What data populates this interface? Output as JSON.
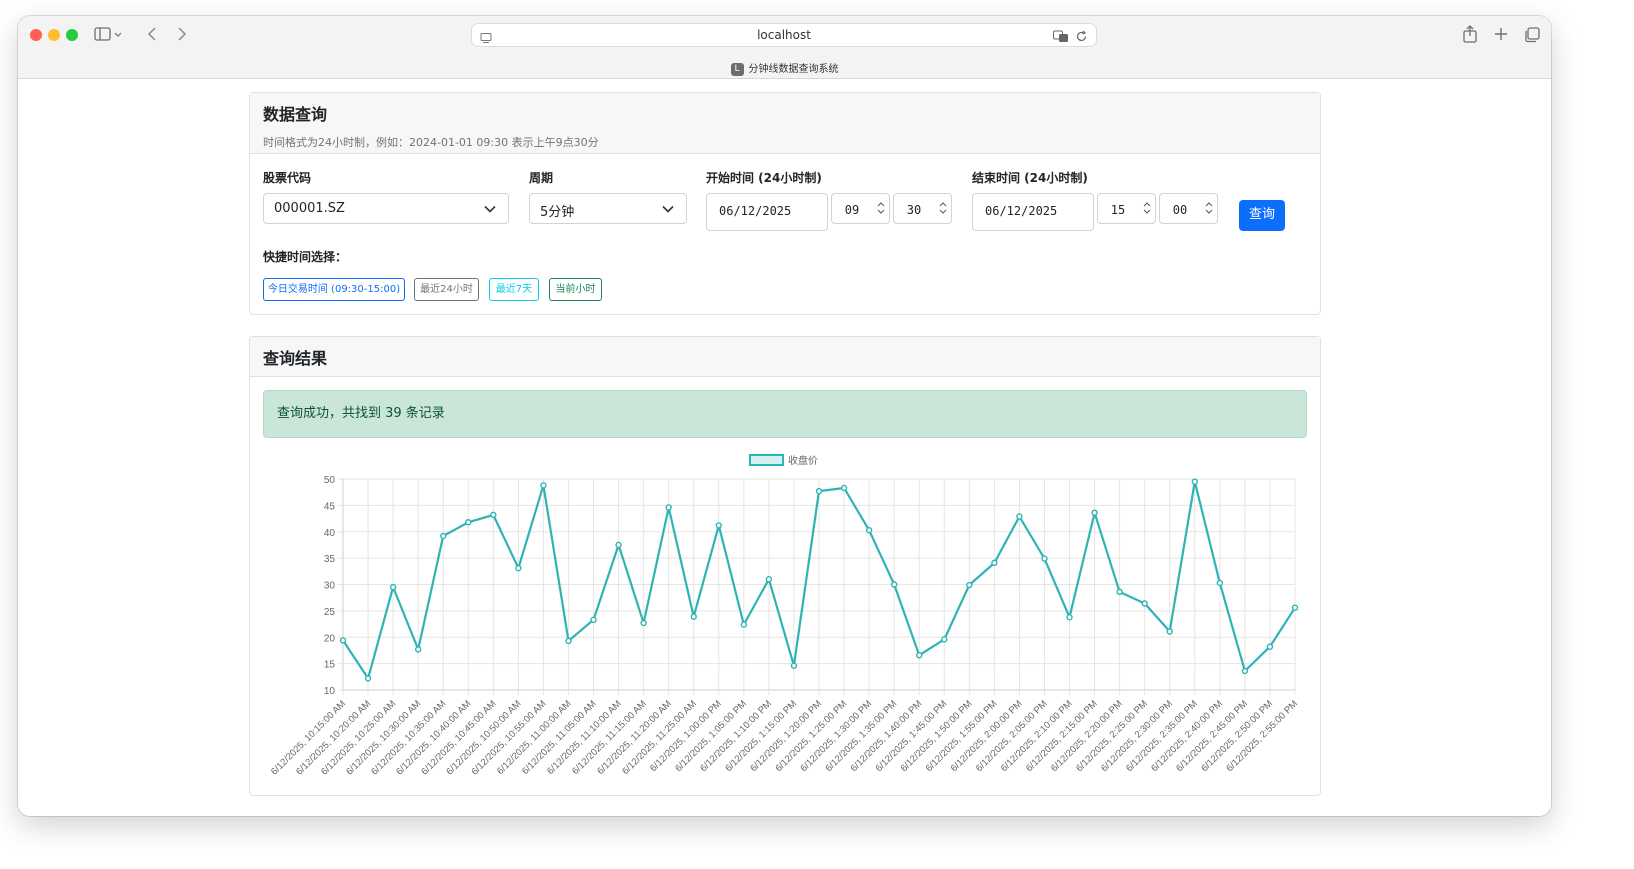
{
  "browser": {
    "url": "localhost",
    "tab_title": "分钟线数据查询系统",
    "tab_favicon_letter": "L"
  },
  "query_card": {
    "title": "数据查询",
    "subtitle": "时间格式为24小时制，例如：2024-01-01 09:30 表示上午9点30分",
    "stock_label": "股票代码",
    "stock_value": "000001.SZ",
    "period_label": "周期",
    "period_value": "5分钟",
    "start_label": "开始时间 (24小时制)",
    "start_date": "06/12/2025",
    "start_hour": "09",
    "start_minute": "30",
    "end_label": "结束时间 (24小时制)",
    "end_date": "06/12/2025",
    "end_hour": "15",
    "end_minute": "00",
    "query_button": "查询",
    "quick_label": "快捷时间选择：",
    "quick_buttons": [
      {
        "label": "今日交易时间 (09:30-15:00)",
        "color": "#0d6efd"
      },
      {
        "label": "最近24小时",
        "color": "#6c757d"
      },
      {
        "label": "最近7天",
        "color": "#0dcaf0"
      },
      {
        "label": "当前小时",
        "color": "#198754"
      }
    ]
  },
  "result_card": {
    "title": "查询结果",
    "alert": "查询成功，共找到 39 条记录"
  },
  "chart_data": {
    "type": "line",
    "legend": [
      "收盘价"
    ],
    "legend_position": "top",
    "line_color": "#2fb3b3",
    "ylim": [
      10,
      50
    ],
    "yticks": [
      10,
      15,
      20,
      25,
      30,
      35,
      40,
      45,
      50
    ],
    "grid": true,
    "categories": [
      "6/12/2025, 10:15:00 AM",
      "6/12/2025, 10:20:00 AM",
      "6/12/2025, 10:25:00 AM",
      "6/12/2025, 10:30:00 AM",
      "6/12/2025, 10:35:00 AM",
      "6/12/2025, 10:40:00 AM",
      "6/12/2025, 10:45:00 AM",
      "6/12/2025, 10:50:00 AM",
      "6/12/2025, 10:55:00 AM",
      "6/12/2025, 11:00:00 AM",
      "6/12/2025, 11:05:00 AM",
      "6/12/2025, 11:10:00 AM",
      "6/12/2025, 11:15:00 AM",
      "6/12/2025, 11:20:00 AM",
      "6/12/2025, 11:25:00 AM",
      "6/12/2025, 1:00:00 PM",
      "6/12/2025, 1:05:00 PM",
      "6/12/2025, 1:10:00 PM",
      "6/12/2025, 1:15:00 PM",
      "6/12/2025, 1:20:00 PM",
      "6/12/2025, 1:25:00 PM",
      "6/12/2025, 1:30:00 PM",
      "6/12/2025, 1:35:00 PM",
      "6/12/2025, 1:40:00 PM",
      "6/12/2025, 1:45:00 PM",
      "6/12/2025, 1:50:00 PM",
      "6/12/2025, 1:55:00 PM",
      "6/12/2025, 2:00:00 PM",
      "6/12/2025, 2:05:00 PM",
      "6/12/2025, 2:10:00 PM",
      "6/12/2025, 2:15:00 PM",
      "6/12/2025, 2:20:00 PM",
      "6/12/2025, 2:25:00 PM",
      "6/12/2025, 2:30:00 PM",
      "6/12/2025, 2:35:00 PM",
      "6/12/2025, 2:40:00 PM",
      "6/12/2025, 2:45:00 PM",
      "6/12/2025, 2:50:00 PM",
      "6/12/2025, 2:55:00 PM"
    ],
    "series": [
      {
        "name": "收盘价",
        "values": [
          19.4,
          12.2,
          29.5,
          17.7,
          39.2,
          41.8,
          43.2,
          33.1,
          48.8,
          19.3,
          23.3,
          37.5,
          22.7,
          44.6,
          23.9,
          41.2,
          22.4,
          31.0,
          14.6,
          47.7,
          48.3,
          40.3,
          30.0,
          16.6,
          19.6,
          29.9,
          34.1,
          42.9,
          34.9,
          23.8,
          43.6,
          28.6,
          26.4,
          21.1,
          49.5,
          30.3,
          13.6,
          18.2,
          25.6
        ]
      }
    ]
  }
}
